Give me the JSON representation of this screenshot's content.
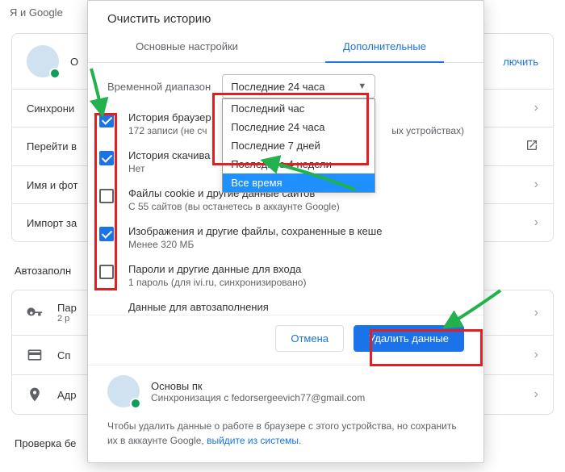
{
  "bg": {
    "header": "Я и Google",
    "profile_initial": "О",
    "enable": "лючить",
    "rows": {
      "sync": "Синхрони",
      "goto": "Перейти в",
      "name": "Имя и фот",
      "import": "Импорт за"
    },
    "autofill_title": "Автозаполн",
    "autofill": {
      "passwords": {
        "label": "Пар",
        "sub": "2 р"
      },
      "payments": "Сп",
      "addresses": "Адр"
    },
    "check": "Проверка бе"
  },
  "dialog": {
    "title": "Очистить историю",
    "tabs": {
      "basic": "Основные настройки",
      "advanced": "Дополнительные"
    },
    "range_label": "Временной диапазон",
    "range_value": "Последние 24 часа",
    "options": [
      "Последний час",
      "Последние 24 часа",
      "Последние 7 дней",
      "Последние 4 недели",
      "Все время"
    ],
    "items": [
      {
        "title": "История браузер",
        "sub": "172 записи (не сч",
        "sub_tail": "ых устройствах)",
        "checked": true
      },
      {
        "title": "История скачива",
        "sub": "Нет",
        "checked": true
      },
      {
        "title": "Файлы cookie и другие данные сайтов",
        "sub": "С 55 сайтов (вы останетесь в аккаунте Google)",
        "checked": false
      },
      {
        "title": "Изображения и другие файлы, сохраненные в кеше",
        "sub": "Менее 320 МБ",
        "checked": true
      },
      {
        "title": "Пароли и другие данные для входа",
        "sub": "1 пароль (для ivi.ru, синхронизировано)",
        "checked": false
      },
      {
        "title": "Данные для автозаполнения",
        "sub": "",
        "checked": false
      }
    ],
    "cancel": "Отмена",
    "confirm": "Удалить данные",
    "profile": {
      "name": "Основы пк",
      "sync": "Синхронизация с fedorsergeevich77@gmail.com"
    },
    "footer_pre": "Чтобы удалить данные о работе в браузере с этого устройства, но сохранить их в аккаунте Google, ",
    "footer_link": "выйдите из системы.",
    "footer_post": ""
  }
}
